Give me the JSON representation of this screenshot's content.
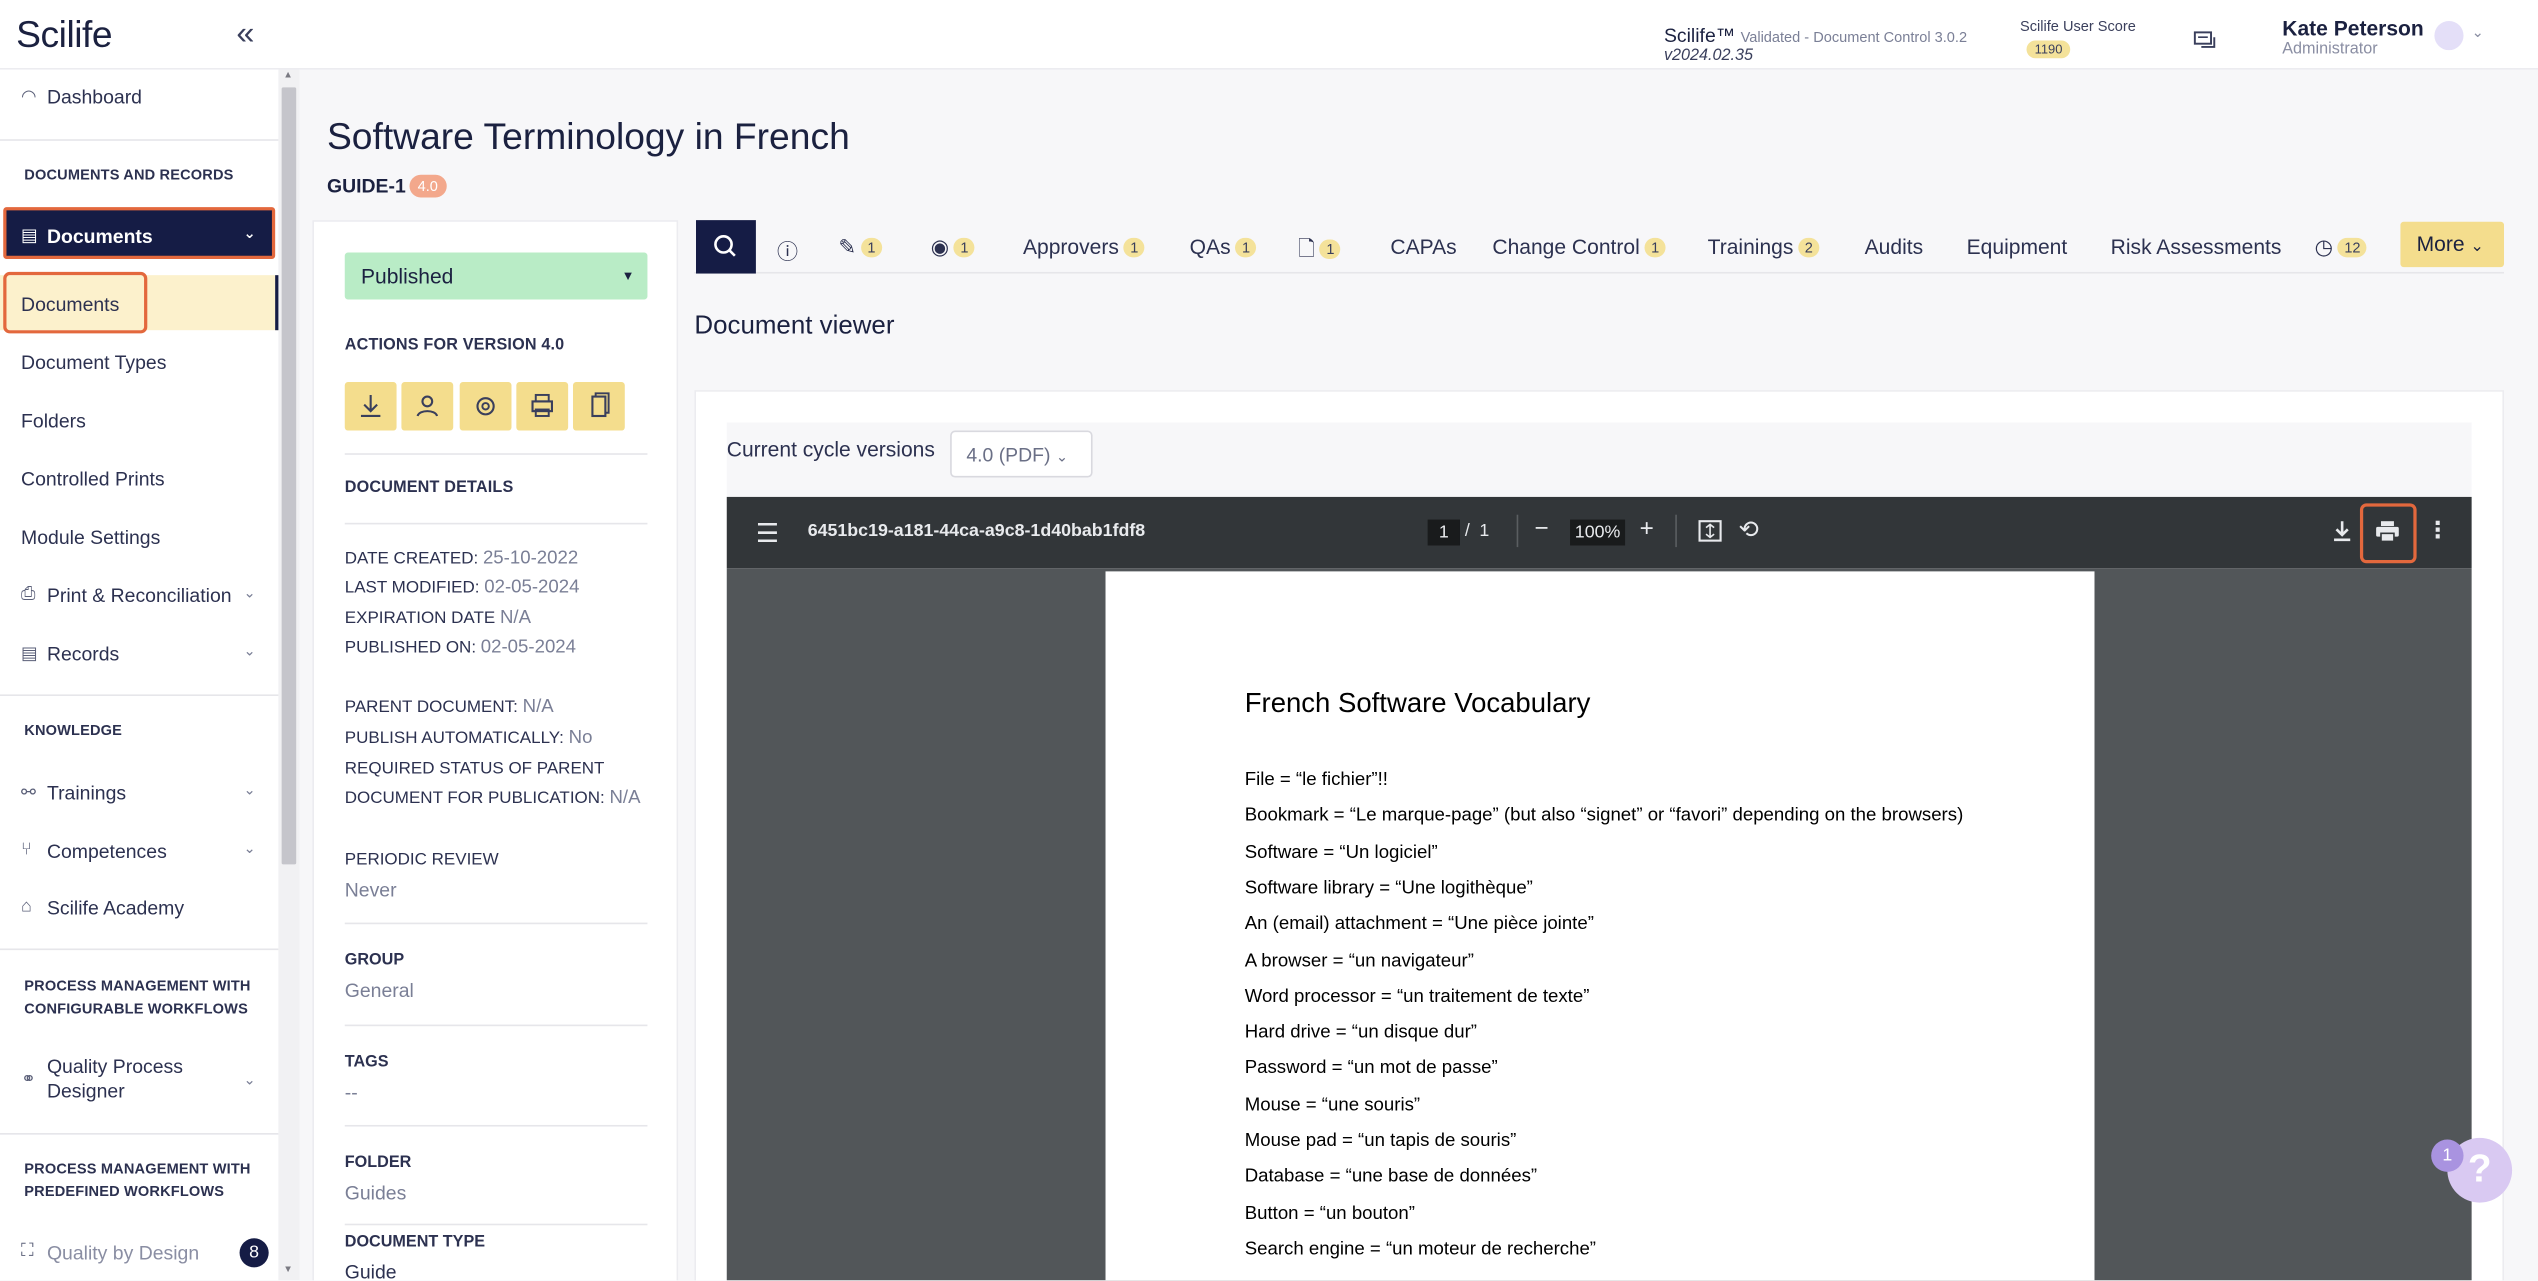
{
  "header": {
    "logo": "Scilife",
    "product": "Scilife™",
    "product_sub": "Validated - Document Control 3.0.2",
    "version": "v2024.02.35",
    "score_label": "Scilife User Score",
    "score_value": "1190",
    "user_name": "Kate Peterson",
    "user_role": "Administrator"
  },
  "sidebar": {
    "dashboard": "Dashboard",
    "section_docs": "DOCUMENTS AND RECORDS",
    "documents": "Documents",
    "sub": [
      "Documents",
      "Document Types",
      "Folders",
      "Controlled Prints",
      "Module Settings"
    ],
    "print_rec": "Print & Reconciliation",
    "records": "Records",
    "section_knowledge": "KNOWLEDGE",
    "trainings": "Trainings",
    "competences": "Competences",
    "academy": "Scilife Academy",
    "section_pm1a": "PROCESS MANAGEMENT WITH",
    "section_pm1b": "CONFIGURABLE WORKFLOWS",
    "qpd_a": "Quality Process",
    "qpd_b": "Designer",
    "section_pm2a": "PROCESS MANAGEMENT WITH",
    "section_pm2b": "PREDEFINED WORKFLOWS",
    "qbd": "Quality by Design"
  },
  "page": {
    "title": "Software Terminology in French",
    "doc_id": "GUIDE-1",
    "version": "4.0"
  },
  "details": {
    "status": "Published",
    "actions_label": "ACTIONS FOR VERSION 4.0",
    "section_label": "DOCUMENT DETAILS",
    "date_created_l": "DATE CREATED:",
    "date_created": "25-10-2022",
    "last_modified_l": "LAST MODIFIED:",
    "last_modified": "02-05-2024",
    "expiration_l": "EXPIRATION DATE",
    "expiration": "N/A",
    "published_l": "PUBLISHED ON:",
    "published": "02-05-2024",
    "parent_l": "PARENT DOCUMENT:",
    "parent": "N/A",
    "publish_auto_l": "PUBLISH AUTOMATICALLY:",
    "publish_auto": "No",
    "req_status_l1": "REQUIRED STATUS OF PARENT",
    "req_status_l2": "DOCUMENT FOR PUBLICATION:",
    "req_status": "N/A",
    "periodic_l": "PERIODIC REVIEW",
    "periodic": "Never",
    "group_l": "GROUP",
    "group": "General",
    "tags_l": "TAGS",
    "tags": "--",
    "folder_l": "FOLDER",
    "folder": "Guides",
    "doctype_l": "DOCUMENT TYPE",
    "doctype": "Guide"
  },
  "tabs": {
    "edit_count": "1",
    "view_count": "1",
    "approvers": "Approvers",
    "approvers_count": "1",
    "qas": "QAs",
    "qas_count": "1",
    "files_count": "1",
    "capas": "CAPAs",
    "change_control": "Change Control",
    "change_count": "1",
    "trainings": "Trainings",
    "trainings_count": "2",
    "audits": "Audits",
    "equipment": "Equipment",
    "risk": "Risk Assessments",
    "history_count": "12",
    "more": "More"
  },
  "viewer": {
    "title": "Document viewer",
    "cycle_label": "Current cycle versions",
    "cycle_value": "4.0 (PDF)",
    "pdf_name": "6451bc19-a181-44ca-a9c8-1d40bab1fdf8",
    "page_current": "1",
    "page_total": "1",
    "zoom": "100%"
  },
  "doc": {
    "heading": "French Software Vocabulary",
    "lines": [
      "File = “le fichier”!!",
      "Bookmark = “Le marque-page” (but also “signet” or “favori” depending on the browsers)",
      "Software = “Un logiciel”",
      "Software library = “Une logithèque”",
      "An (email) attachment = “Une pièce jointe”",
      "A browser = “un navigateur”",
      "Word processor = “un traitement de texte”",
      "Hard drive = “un disque dur”",
      "Password = “un mot de passe”",
      "Mouse = “une souris”",
      "Mouse pad = “un tapis de souris”",
      "Database = “une base de données”",
      "Button = “un bouton”",
      "Search engine = “un moteur de recherche”"
    ]
  },
  "help": {
    "fab": "?",
    "fab_badge": "1",
    "qbd_badge": "8"
  }
}
